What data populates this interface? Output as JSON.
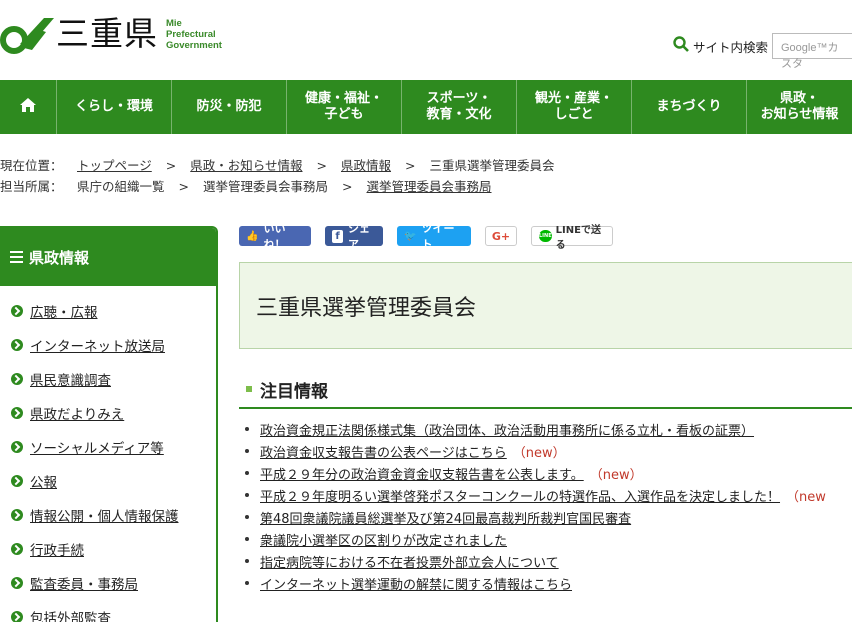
{
  "header": {
    "logo_name": "三重県",
    "logo_en": [
      "Mie",
      "Prefectural",
      "Government"
    ],
    "search_label": "サイト内検索",
    "search_placeholder": "Google™カスタ"
  },
  "gnav": [
    {
      "label": "",
      "icon": "home-icon"
    },
    {
      "label": "くらし・環境"
    },
    {
      "label": "防災・防犯"
    },
    {
      "label": "健康・福祉・\n子ども"
    },
    {
      "label": "スポーツ・\n教育・文化"
    },
    {
      "label": "観光・産業・\nしごと"
    },
    {
      "label": "まちづくり"
    },
    {
      "label": "県政・\nお知らせ情報"
    }
  ],
  "breadcrumb": {
    "current_label": "現在位置：",
    "current": [
      "トップページ",
      "県政・お知らせ情報",
      "県政情報",
      "三重県選挙管理委員会"
    ],
    "dept_label": "担当所属：",
    "dept": [
      "県庁の組織一覧",
      "選挙管理委員会事務局",
      "選挙管理委員会事務局"
    ]
  },
  "sidebar": {
    "title": "県政情報",
    "items": [
      "広聴・広報",
      "インターネット放送局",
      "県民意識調査",
      "県政だよりみえ",
      "ソーシャルメディア等",
      "公報",
      "情報公開・個人情報保護",
      "行政手続",
      "監査委員・事務局",
      "包括外部監査"
    ]
  },
  "social": {
    "like": "いいね！",
    "share": "シェア",
    "tweet": "ツイート",
    "gplus": "G+",
    "line": "LINEで送る",
    "line_badge": "LINE"
  },
  "page_title": "三重県選挙管理委員会",
  "section": {
    "title": "注目情報",
    "items": [
      {
        "text": "政治資金規正法関係様式集（政治団体、政治活動用事務所に係る立札・看板の証票）",
        "new": ""
      },
      {
        "text": "政治資金収支報告書の公表ページはこちら",
        "new": "（new）"
      },
      {
        "text": "平成２９年分の政治資金資金収支報告書を公表します。",
        "new": "（new）"
      },
      {
        "text": "平成２９年度明るい選挙啓発ポスターコンクールの特選作品、入選作品を決定しました！",
        "new": "（new"
      },
      {
        "text": "第48回衆議院議員総選挙及び第24回最高裁判所裁判官国民審査",
        "new": ""
      },
      {
        "text": "衆議院小選挙区の区割りが改定されました",
        "new": ""
      },
      {
        "text": "指定病院等における不在者投票外部立会人について",
        "new": ""
      },
      {
        "text": "インターネット選挙運動の解禁に関する情報はこちら",
        "new": ""
      }
    ]
  },
  "colors": {
    "brand_green": "#2e8a1f",
    "title_bg": "#eef6e7",
    "new_red": "#c1392b"
  }
}
